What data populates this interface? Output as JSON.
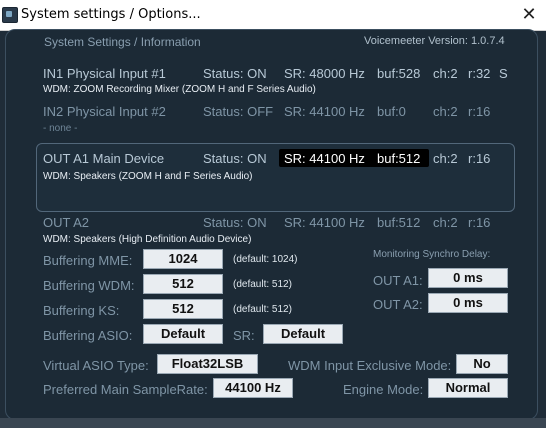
{
  "window": {
    "title": "System settings / Options...",
    "close_glyph": "✕"
  },
  "header": {
    "section": "System Settings / Information",
    "version": "Voicemeeter Version: 1.0.7.4"
  },
  "devices": {
    "in1": {
      "name": "IN1 Physical Input #1",
      "status": "Status: ON",
      "sr": "SR: 48000 Hz",
      "buf": "buf:528",
      "ch": "ch:2",
      "r": "r:32",
      "flag": "S",
      "driver": "WDM: ZOOM Recording Mixer (ZOOM H and F Series Audio)"
    },
    "in2": {
      "name": "IN2 Physical Input #2",
      "status": "Status: OFF",
      "sr": "SR: 44100 Hz",
      "buf": "buf:0",
      "ch": "ch:2",
      "r": "r:16",
      "driver": "- none -"
    },
    "a1": {
      "name": "OUT A1 Main Device",
      "status": "Status: ON",
      "sr": "SR: 44100 Hz",
      "buf": "buf:512",
      "ch": "ch:2",
      "r": "r:16",
      "driver": "WDM: Speakers (ZOOM H and F Series Audio)"
    },
    "a2": {
      "name": "OUT A2",
      "status": "Status: ON",
      "sr": "SR: 44100 Hz",
      "buf": "buf:512",
      "ch": "ch:2",
      "r": "r:16",
      "driver": "WDM: Speakers (High Definition Audio Device)"
    }
  },
  "buffering": {
    "mme": {
      "label": "Buffering MME:",
      "value": "1024",
      "default": "(default: 1024)"
    },
    "wdm": {
      "label": "Buffering WDM:",
      "value": "512",
      "default": "(default: 512)"
    },
    "ks": {
      "label": "Buffering KS:",
      "value": "512",
      "default": "(default: 512)"
    },
    "asio": {
      "label": "Buffering ASIO:",
      "value": "Default",
      "sr_label": "SR:",
      "sr_value": "Default"
    }
  },
  "monitoring": {
    "title": "Monitoring Synchro Delay:",
    "a1_label": "OUT A1:",
    "a1_value": "0 ms",
    "a2_label": "OUT A2:",
    "a2_value": "0 ms"
  },
  "options": {
    "asio_type_label": "Virtual ASIO Type:",
    "asio_type_value": "Float32LSB",
    "wdm_exclusive_label": "WDM Input Exclusive Mode:",
    "wdm_exclusive_value": "No",
    "samplerate_label": "Preferred Main SampleRate:",
    "samplerate_value": "44100 Hz",
    "engine_label": "Engine Mode:",
    "engine_value": "Normal"
  }
}
